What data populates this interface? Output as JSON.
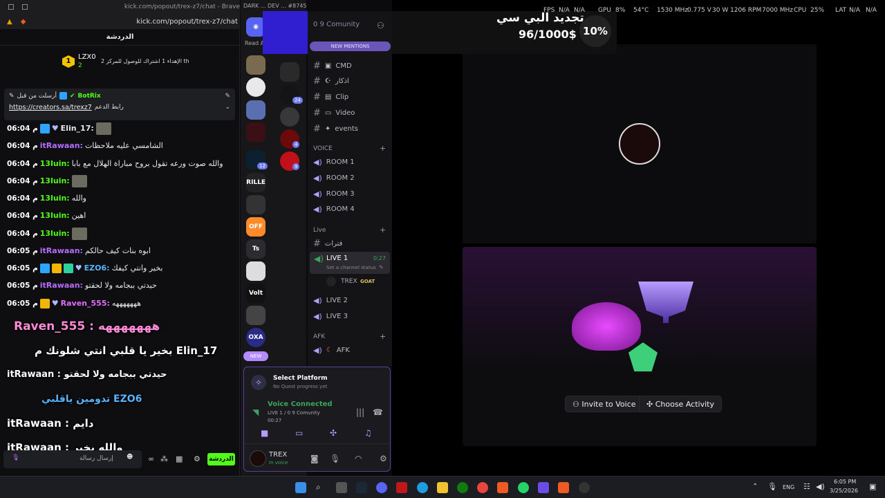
{
  "browser": {
    "title": "kick.com/popout/trex-z7/chat - Brave",
    "url": "kick.com/popout/trex-z7/chat"
  },
  "kick": {
    "chat_title": "الدردشة",
    "gifter": {
      "name": "LZX0",
      "count": "2",
      "text": "الإهداء 1 اشتراك للوصول للمركز 2 th"
    },
    "pinned": {
      "author_label": "أرسلت من قبل",
      "bot": "BotRix",
      "label": "رابط الدعم",
      "link": "https://creators.sa/trexz7"
    },
    "messages": [
      {
        "time": "06:04 م",
        "user": "Elin_17:",
        "text": ""
      },
      {
        "time": "06:04 م",
        "user": "itRawaan:",
        "text": "الشامسي عليه ملاحظات"
      },
      {
        "time": "06:04 م",
        "user": "13luin:",
        "text": "والله صوت ورعه تقول بروح مباراة الهلال مع بابا"
      },
      {
        "time": "06:04 م",
        "user": "13luin:",
        "text": ""
      },
      {
        "time": "06:04 م",
        "user": "13luin:",
        "text": "والله"
      },
      {
        "time": "06:04 م",
        "user": "13luin:",
        "text": "اهين"
      },
      {
        "time": "06:04 م",
        "user": "13luin:",
        "text": ""
      },
      {
        "time": "06:05 م",
        "user": "itRawaan:",
        "text": "ابوه بنات كيف حالكم"
      },
      {
        "time": "06:05 م",
        "user": "EZO6:",
        "text": "بخير وانتي كيفك"
      },
      {
        "time": "06:05 م",
        "user": "itRawaan:",
        "text": "حيدتي ببجامه ولا لحقتو"
      },
      {
        "time": "06:05 م",
        "user": "Raven_555:",
        "text": "هههههههه"
      }
    ],
    "overlays": [
      {
        "text": "Raven_555 : هههههههه"
      },
      {
        "text": "بخير يا قلبي انتي شلونك م Elin_17"
      },
      {
        "text": "itRawaan : حيدتي ببجامه ولا لحقتو"
      },
      {
        "text": "تدومين ياقلبي EZO6"
      },
      {
        "text": "itRawaan : دايم"
      },
      {
        "text": "itRawaan : والله بخير"
      }
    ],
    "input_placeholder": "إرسال رسالة",
    "send_label": "الدردشة",
    "colors": {
      "accent": "#53fc18",
      "user_green": "#53fc18",
      "user_blue": "#5ab4ff",
      "user_pink": "#e06cff"
    }
  },
  "discord": {
    "read_all": "Read All",
    "new_badge": "NEW",
    "server_name": "0 9 Comunity",
    "new_mentions": "NEW MENTIONS",
    "server_badges": [
      "12",
      "24",
      "4",
      "9",
      "1"
    ],
    "text_channels": [
      "CMD",
      "اذكار",
      "Clip",
      "Video",
      "events"
    ],
    "voice_section": "VOICE",
    "voice_channels": [
      "ROOM 1",
      "ROOM 2",
      "ROOM 3",
      "ROOM 4"
    ],
    "live_section": "Live",
    "live_text_channel": "فترات",
    "live1": {
      "name": "LIVE 1",
      "timer": "0:27",
      "status_placeholder": "Set a channel status",
      "member": "TREX",
      "member_badge": "GOAT"
    },
    "live_channels": [
      "LIVE 2",
      "LIVE 3"
    ],
    "afk_section": "AFK",
    "afk_channel": "AFK",
    "quest": {
      "title": "Select Platform",
      "subtitle": "No Quest progress yet"
    },
    "voice": {
      "status": "Voice Connected",
      "channel": "LIVE 1 / 0 9 Comunity",
      "time": "00:27"
    },
    "user": {
      "name": "TREX",
      "status": "In voice"
    },
    "popup": {
      "title": "تجديد البي سي",
      "progress": "96/1000$",
      "percent": "10%"
    },
    "popup_header": "DARK ... DEV ... #8745",
    "buttons": {
      "invite": "Invite to Voice",
      "activity": "Choose Activity"
    }
  },
  "hud": {
    "fps": "FPS",
    "fps_val": "N/A",
    "fps_val2": "N/A",
    "gpu": "GPU",
    "gpu_load": "8%",
    "gpu_temp": "54°C",
    "gpu_clock": "1530 MHz",
    "gpu_volt": "0.775 V",
    "gpu_power": "30 W",
    "gpu_fan": "1206 RPM",
    "gpu_mem": "7000 MHz",
    "cpu": "CPU",
    "cpu_load": "25%",
    "lat": "LAT",
    "lat_val": "N/A",
    "lat_val2": "N/A"
  },
  "taskbar": {
    "lang": "ENG",
    "time": "6:05 PM",
    "date": "3/25/2026"
  }
}
